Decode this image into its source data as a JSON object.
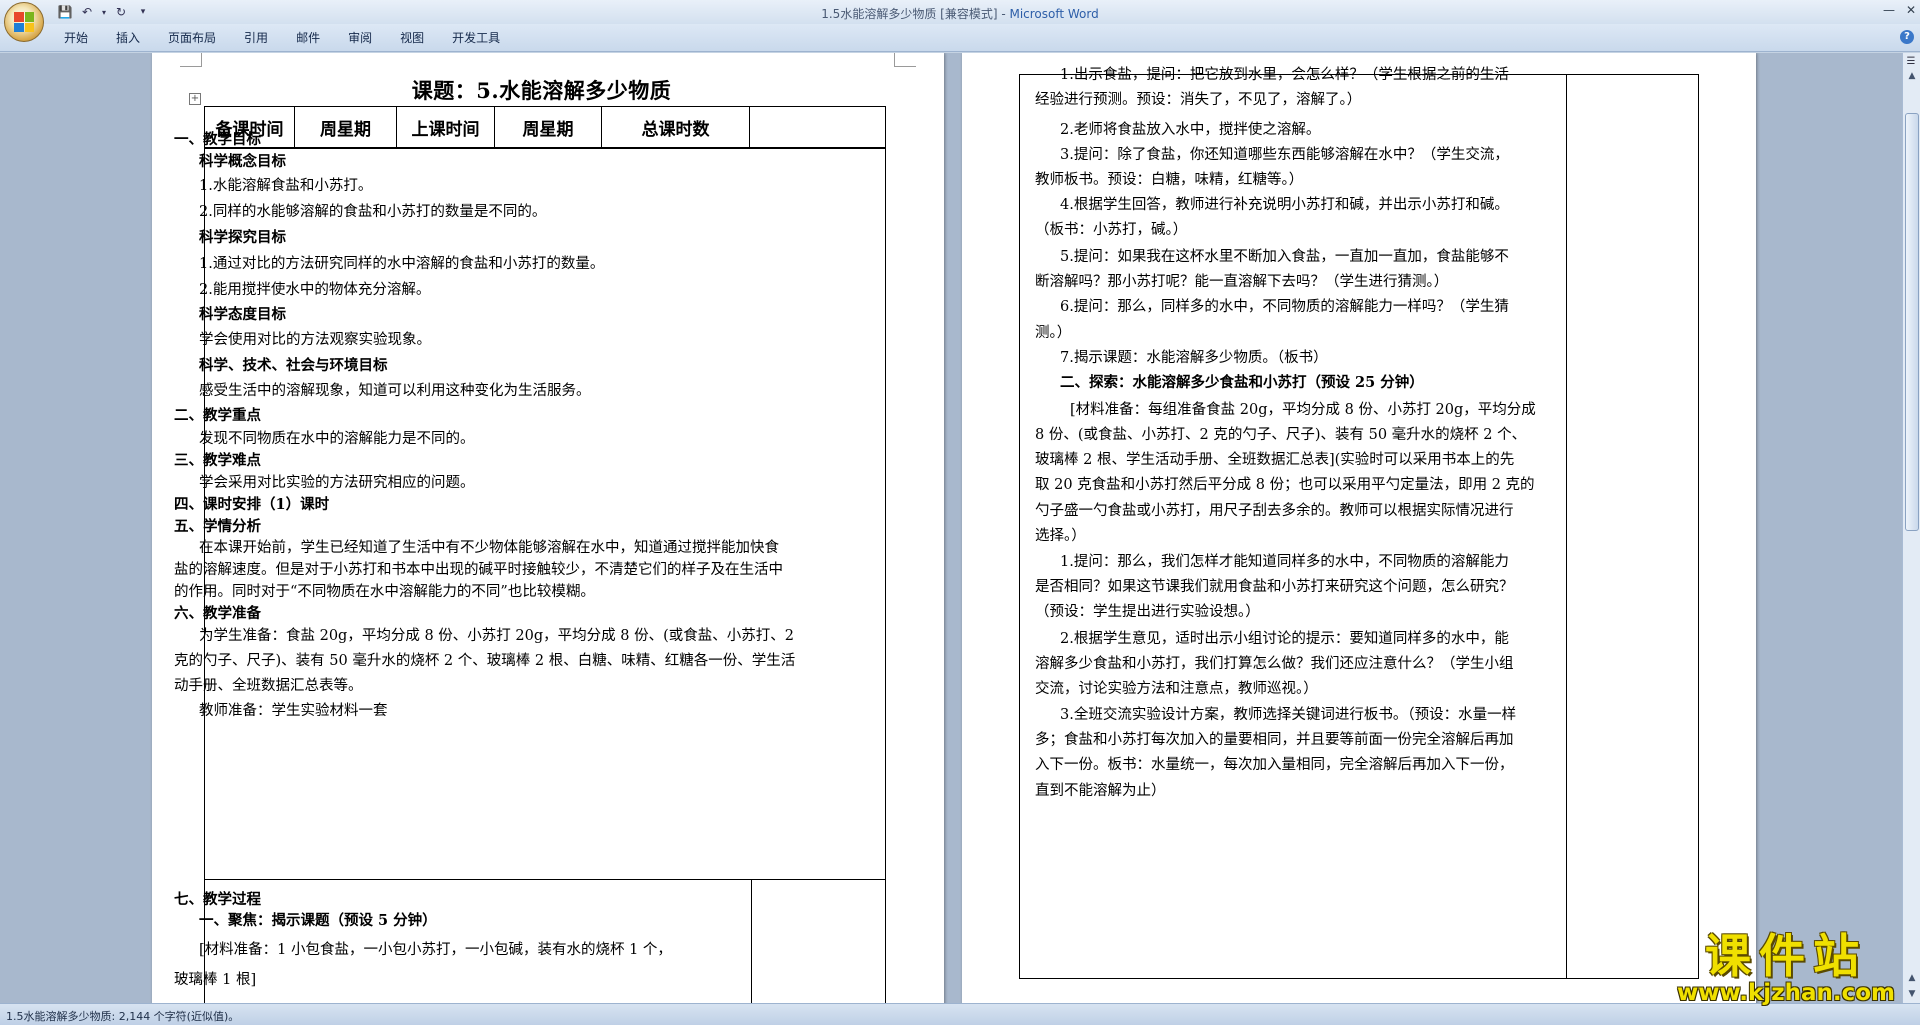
{
  "window": {
    "doc_name": "1.5水能溶解多少物质 [兼容模式]",
    "separator": " - ",
    "app_name": "Microsoft Word"
  },
  "ribbon": {
    "tabs": [
      "开始",
      "插入",
      "页面布局",
      "引用",
      "邮件",
      "审阅",
      "视图",
      "开发工具"
    ]
  },
  "left_page": {
    "title": "课题：5.水能溶解多少物质",
    "header": [
      "备课时间",
      "周星期",
      "上课时间",
      "周星期",
      "总课时数",
      ""
    ],
    "lines": [
      {
        "text": "一、教学目标",
        "bold": true
      },
      {
        "text": "科学概念目标",
        "bold": true
      },
      {
        "text": "1.水能溶解食盐和小苏打。",
        "bold": false
      },
      {
        "text": "2.同样的水能够溶解的食盐和小苏打的数量是不同的。",
        "bold": false
      },
      {
        "text": "科学探究目标",
        "bold": true
      },
      {
        "text": "1.通过对比的方法研究同样的水中溶解的食盐和小苏打的数量。",
        "bold": false
      },
      {
        "text": "2.能用搅拌使水中的物体充分溶解。",
        "bold": false
      },
      {
        "text": "科学态度目标",
        "bold": true
      },
      {
        "text": "学会使用对比的方法观察实验现象。",
        "bold": false
      },
      {
        "text": "科学、技术、社会与环境目标",
        "bold": true
      },
      {
        "text": "感受生活中的溶解现象，知道可以利用这种变化为生活服务。",
        "bold": false
      },
      {
        "text": "二、教学重点",
        "bold": true
      },
      {
        "text": "发现不同物质在水中的溶解能力是不同的。",
        "bold": false
      },
      {
        "text": "三、教学难点",
        "bold": true
      },
      {
        "text": "学会采用对比实验的方法研究相应的问题。",
        "bold": false
      },
      {
        "text": "四、课时安排（1）课时",
        "bold": true
      },
      {
        "text": "五、学情分析",
        "bold": true
      },
      {
        "text": "在本课开始前，学生已经知道了生活中有不少物体能够溶解在水中，知道通过搅拌能加快食",
        "bold": false
      },
      {
        "text": "盐的溶解速度。但是对于小苏打和书本中出现的碱平时接触较少，不清楚它们的样子及在生活中",
        "bold": false
      },
      {
        "text": "的作用。同时对于“不同物质在水中溶解能力的不同”也比较模糊。",
        "bold": false
      },
      {
        "text": "六、教学准备",
        "bold": true
      },
      {
        "text": "为学生准备：食盐 20g，平均分成 8 份、小苏打 20g，平均分成 8 份、(或食盐、小苏打、2",
        "bold": false
      },
      {
        "text": "克的勺子、尺子)、装有 50 毫升水的烧杯 2 个、玻璃棒 2 根、白糖、味精、红糖各一份、学生活",
        "bold": false
      },
      {
        "text": "动手册、全班数据汇总表等。",
        "bold": false
      },
      {
        "text": "教师准备：学生实验材料一套",
        "bold": false
      }
    ],
    "process_lines": [
      {
        "text": "七、教学过程",
        "bold": true
      },
      {
        "text": "一、聚焦：揭示课题（预设 5 分钟）",
        "bold": true
      },
      {
        "text": "[材料准备：1 小包食盐，一小包小苏打，一小包碱，装有水的烧杯 1 个，",
        "bold": false
      },
      {
        "text": "玻璃棒 1 根]",
        "bold": false
      }
    ]
  },
  "right_page": {
    "lines": [
      {
        "text": "1.出示食盐，提问：把它放到水里，会怎么样？（学生根据之前的生活",
        "bold": false
      },
      {
        "text": "经验进行预测。预设：消失了，不见了，溶解了。）",
        "bold": false
      },
      {
        "text": "2.老师将食盐放入水中，搅拌使之溶解。",
        "bold": false
      },
      {
        "text": "3.提问：除了食盐，你还知道哪些东西能够溶解在水中？（学生交流，",
        "bold": false
      },
      {
        "text": "教师板书。预设：白糖，味精，红糖等。）",
        "bold": false
      },
      {
        "text": "4.根据学生回答，教师进行补充说明小苏打和碱，并出示小苏打和碱。",
        "bold": false
      },
      {
        "text": "（板书：小苏打，碱。）",
        "bold": false
      },
      {
        "text": "5.提问：如果我在这杯水里不断加入食盐，一直加一直加，食盐能够不",
        "bold": false
      },
      {
        "text": "断溶解吗？那小苏打呢？能一直溶解下去吗？（学生进行猜测。）",
        "bold": false
      },
      {
        "text": "6.提问：那么，同样多的水中，不同物质的溶解能力一样吗？（学生猜",
        "bold": false
      },
      {
        "text": "测。）",
        "bold": false
      },
      {
        "text": "7.揭示课题：水能溶解多少物质。（板书）",
        "bold": false
      },
      {
        "text": "二、探索：水能溶解多少食盐和小苏打（预设 25 分钟）",
        "bold": true
      },
      {
        "text": "[材料准备：每组准备食盐 20g，平均分成 8 份、小苏打 20g，平均分成",
        "bold": false
      },
      {
        "text": "8 份、(或食盐、小苏打、2 克的勺子、尺子)、装有 50 毫升水的烧杯 2 个、",
        "bold": false
      },
      {
        "text": "玻璃棒 2 根、学生活动手册、全班数据汇总表](实验时可以采用书本上的先",
        "bold": false
      },
      {
        "text": "取 20 克食盐和小苏打然后平分成 8 份；也可以采用平勺定量法，即用 2 克的",
        "bold": false
      },
      {
        "text": "勺子盛一勺食盐或小苏打，用尺子刮去多余的。教师可以根据实际情况进行",
        "bold": false
      },
      {
        "text": "选择。）",
        "bold": false
      },
      {
        "text": "1.提问：那么，我们怎样才能知道同样多的水中，不同物质的溶解能力",
        "bold": false
      },
      {
        "text": "是否相同？如果这节课我们就用食盐和小苏打来研究这个问题，怎么研究？",
        "bold": false
      },
      {
        "text": "（预设：学生提出进行实验设想。）",
        "bold": false
      },
      {
        "text": "2.根据学生意见，适时出示小组讨论的提示：要知道同样多的水中，能",
        "bold": false
      },
      {
        "text": "溶解多少食盐和小苏打，我们打算怎么做？我们还应注意什么？（学生小组",
        "bold": false
      },
      {
        "text": "交流，讨论实验方法和注意点，教师巡视。）",
        "bold": false
      },
      {
        "text": "3.全班交流实验设计方案，教师选择关键词进行板书。（预设：水量一样",
        "bold": false
      },
      {
        "text": "多；食盐和小苏打每次加入的量要相同，并且要等前面一份完全溶解后再加",
        "bold": false
      },
      {
        "text": "入下一份。板书：水量统一，每次加入量相同，完全溶解后再加入下一份，",
        "bold": false
      },
      {
        "text": "直到不能溶解为止）",
        "bold": false
      }
    ]
  },
  "status": {
    "text": "1.5水能溶解多少物质: 2,144 个字符(近似值)。"
  },
  "watermark": {
    "title": "课件站",
    "url": "www.kjzhan.com"
  }
}
